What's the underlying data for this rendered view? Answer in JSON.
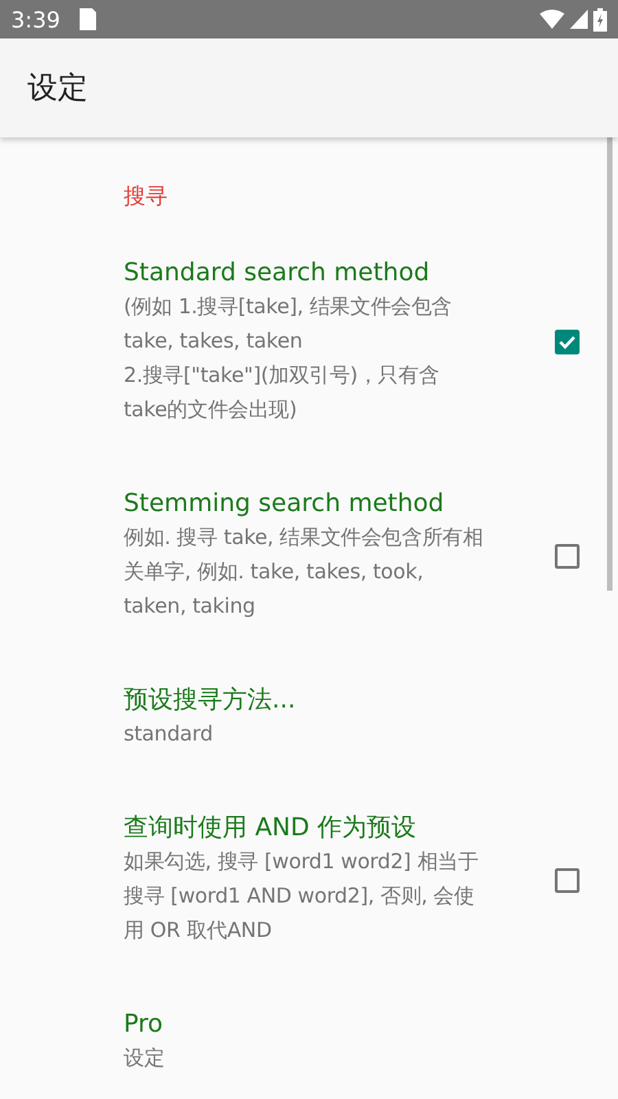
{
  "status_bar": {
    "time": "3:39"
  },
  "app_bar": {
    "title": "设定"
  },
  "category": {
    "title": "搜寻"
  },
  "items": [
    {
      "kind": "checkbox",
      "title": "Standard search method",
      "summary": "(例如 1.搜寻[take], 结果文件会包含\ntake, takes, taken\n2.搜寻[\"take\"](加双引号)，只有含\ntake的文件会出现)",
      "checked": true
    },
    {
      "kind": "checkbox",
      "title": "Stemming search method",
      "summary": "例如. 搜寻 take, 结果文件会包含所有相关单字, 例如. take, takes, took, taken, taking",
      "checked": false
    },
    {
      "kind": "list",
      "title": "预设搜寻方法...",
      "summary": "standard"
    },
    {
      "kind": "checkbox",
      "title": "查询时使用 AND 作为预设",
      "summary": "如果勾选, 搜寻 [word1 word2] 相当于搜寻 [word1 AND word2], 否则, 会使用 OR 取代AND",
      "checked": false
    },
    {
      "kind": "plain",
      "title": "Pro",
      "summary": "设定"
    }
  ]
}
